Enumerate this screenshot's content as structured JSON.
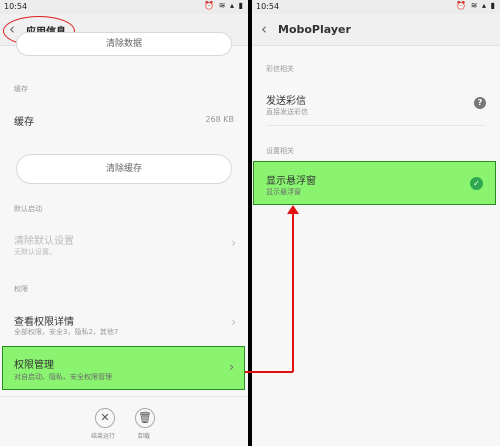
{
  "status_bar": {
    "time": "10:54",
    "icons": "⏰ ≋ ▴ ▮"
  },
  "left": {
    "header_title": "应用信息",
    "clear_data_button": "清除数据",
    "cache_section_label": "缓存",
    "cache_label": "缓存",
    "cache_value": "268 KB",
    "clear_cache_button": "清除缓存",
    "default_launch_label": "默认启动",
    "clear_defaults_title": "清除默认设置",
    "clear_defaults_sub": "无默认设置。",
    "permissions_label": "权限",
    "view_permissions_title": "查看权限详情",
    "view_permissions_sub": "全部权限，安全3，隐私2，其他7",
    "permission_manage_title": "权限管理",
    "permission_manage_sub": "对自启动、隐私、安全权限管理",
    "force_stop_label": "结束运行",
    "uninstall_label": "卸载"
  },
  "right": {
    "header_title": "MoboPlayer",
    "sms_section_label": "彩信相关",
    "send_mms_title": "发送彩信",
    "send_mms_sub": "直接发送彩信",
    "settings_section_label": "设置相关",
    "float_window_title": "显示悬浮窗",
    "float_window_sub": "显示悬浮窗"
  },
  "colors": {
    "highlight": "#8af470",
    "annotation": "#e01010",
    "check": "#2fa84f"
  }
}
